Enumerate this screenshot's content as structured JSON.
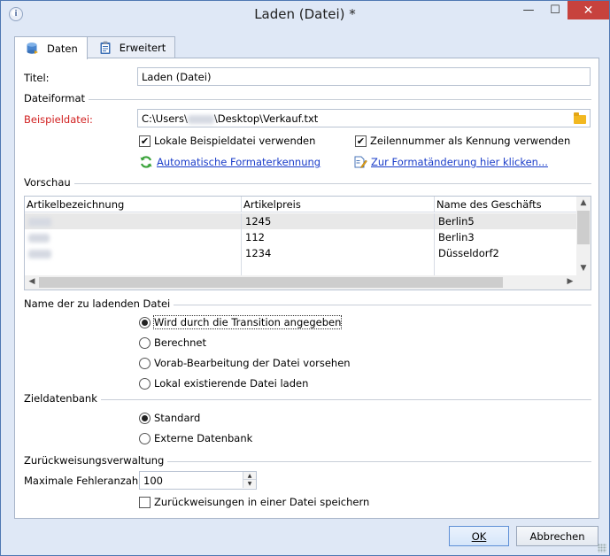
{
  "window": {
    "title": "Laden (Datei) *",
    "min_glyph": "—",
    "max_glyph": "☐",
    "close_glyph": "✕"
  },
  "tabs": [
    {
      "label": "Daten",
      "active": true,
      "icon": "database-icon"
    },
    {
      "label": "Erweitert",
      "active": false,
      "icon": "clipboard-icon"
    }
  ],
  "form": {
    "title_label": "Titel:",
    "title_value": "Laden (Datei)",
    "dateiformat_section": "Dateiformat",
    "beispiel_label": "Beispieldatei:",
    "beispiel_value_prefix": "C:\\Users\\",
    "beispiel_value_suffix": "\\Desktop\\Verkauf.txt",
    "chk_local_label": "Lokale Beispieldatei verwenden",
    "chk_local_checked": true,
    "chk_rownum_label": "Zeilennummer als Kennung verwenden",
    "chk_rownum_checked": true,
    "link_auto_format": "Automatische Formaterkennung",
    "link_change_format": "Zur Formatänderung hier klicken..."
  },
  "preview": {
    "section": "Vorschau",
    "columns": [
      "Artikelbezeichnung",
      "Artikelpreis",
      "Name des Geschäfts"
    ],
    "rows": [
      [
        "",
        "1245",
        "Berlin5"
      ],
      [
        "",
        "112",
        "Berlin3"
      ],
      [
        "",
        "1234",
        "Düsseldorf2"
      ]
    ]
  },
  "load_file": {
    "section": "Name der zu ladenden Datei",
    "options": [
      {
        "label": "Wird durch die Transition angegeben",
        "selected": true
      },
      {
        "label": "Berechnet",
        "selected": false
      },
      {
        "label": "Vorab-Bearbeitung der Datei vorsehen",
        "selected": false
      },
      {
        "label": "Lokal existierende Datei laden",
        "selected": false
      }
    ]
  },
  "target_db": {
    "section": "Zieldatenbank",
    "options": [
      {
        "label": "Standard",
        "selected": true
      },
      {
        "label": "Externe Datenbank",
        "selected": false
      }
    ]
  },
  "rejects": {
    "section": "Zurückweisungsverwaltung",
    "max_errors_label": "Maximale Fehleranzahl:",
    "max_errors_value": "100",
    "save_rejects_label": "Zurückweisungen in einer Datei speichern",
    "save_rejects_checked": false
  },
  "buttons": {
    "ok": "OK",
    "cancel": "Abbrechen"
  }
}
